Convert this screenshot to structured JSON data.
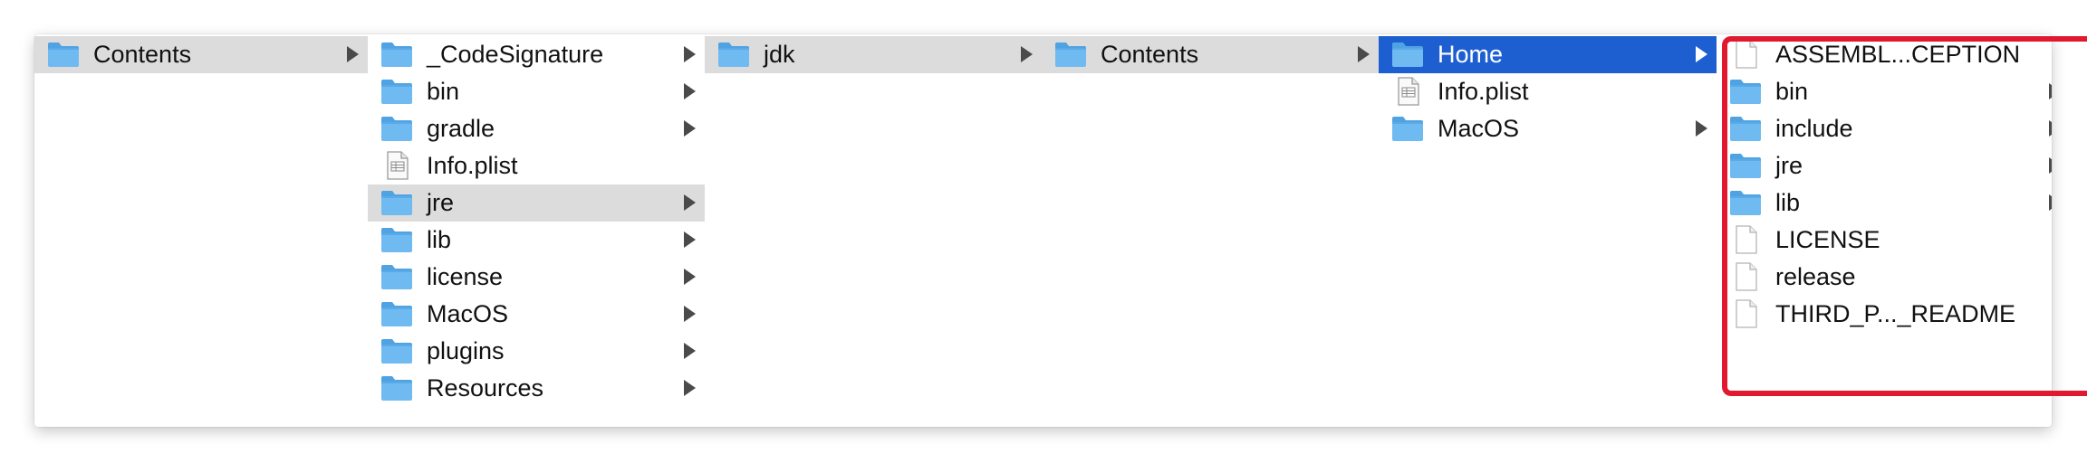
{
  "window": {
    "accent_color": "#1d5fd1",
    "highlight_color": "#e0192f"
  },
  "columns": [
    {
      "name": "column-1",
      "items": [
        {
          "label": "Contents",
          "icon": "folder-icon",
          "arrow": true,
          "selected": "gray"
        }
      ]
    },
    {
      "name": "column-2",
      "items": [
        {
          "label": "_CodeSignature",
          "icon": "folder-icon",
          "arrow": true
        },
        {
          "label": "bin",
          "icon": "folder-icon",
          "arrow": true
        },
        {
          "label": "gradle",
          "icon": "folder-icon",
          "arrow": true
        },
        {
          "label": "Info.plist",
          "icon": "plist-file-icon",
          "arrow": false
        },
        {
          "label": "jre",
          "icon": "folder-icon",
          "arrow": true,
          "selected": "gray"
        },
        {
          "label": "lib",
          "icon": "folder-icon",
          "arrow": true
        },
        {
          "label": "license",
          "icon": "folder-icon",
          "arrow": true
        },
        {
          "label": "MacOS",
          "icon": "folder-icon",
          "arrow": true
        },
        {
          "label": "plugins",
          "icon": "folder-icon",
          "arrow": true
        },
        {
          "label": "Resources",
          "icon": "folder-icon",
          "arrow": true
        }
      ]
    },
    {
      "name": "column-3",
      "items": [
        {
          "label": "jdk",
          "icon": "folder-icon",
          "arrow": true,
          "selected": "gray"
        }
      ]
    },
    {
      "name": "column-4",
      "items": [
        {
          "label": "Contents",
          "icon": "folder-icon",
          "arrow": true,
          "selected": "gray"
        }
      ]
    },
    {
      "name": "column-5",
      "items": [
        {
          "label": "Home",
          "icon": "folder-icon",
          "arrow": true,
          "selected": "blue"
        },
        {
          "label": "Info.plist",
          "icon": "plist-file-icon",
          "arrow": false
        },
        {
          "label": "MacOS",
          "icon": "folder-icon",
          "arrow": true
        }
      ]
    },
    {
      "name": "column-6",
      "items": [
        {
          "label": "ASSEMBL...CEPTION",
          "icon": "document-icon",
          "arrow": false
        },
        {
          "label": "bin",
          "icon": "folder-icon",
          "arrow": true
        },
        {
          "label": "include",
          "icon": "folder-icon",
          "arrow": true
        },
        {
          "label": "jre",
          "icon": "folder-icon",
          "arrow": true
        },
        {
          "label": "lib",
          "icon": "folder-icon",
          "arrow": true
        },
        {
          "label": "LICENSE",
          "icon": "document-icon",
          "arrow": false
        },
        {
          "label": "release",
          "icon": "document-icon",
          "arrow": false
        },
        {
          "label": "THIRD_P..._README",
          "icon": "document-icon",
          "arrow": false
        }
      ]
    }
  ]
}
